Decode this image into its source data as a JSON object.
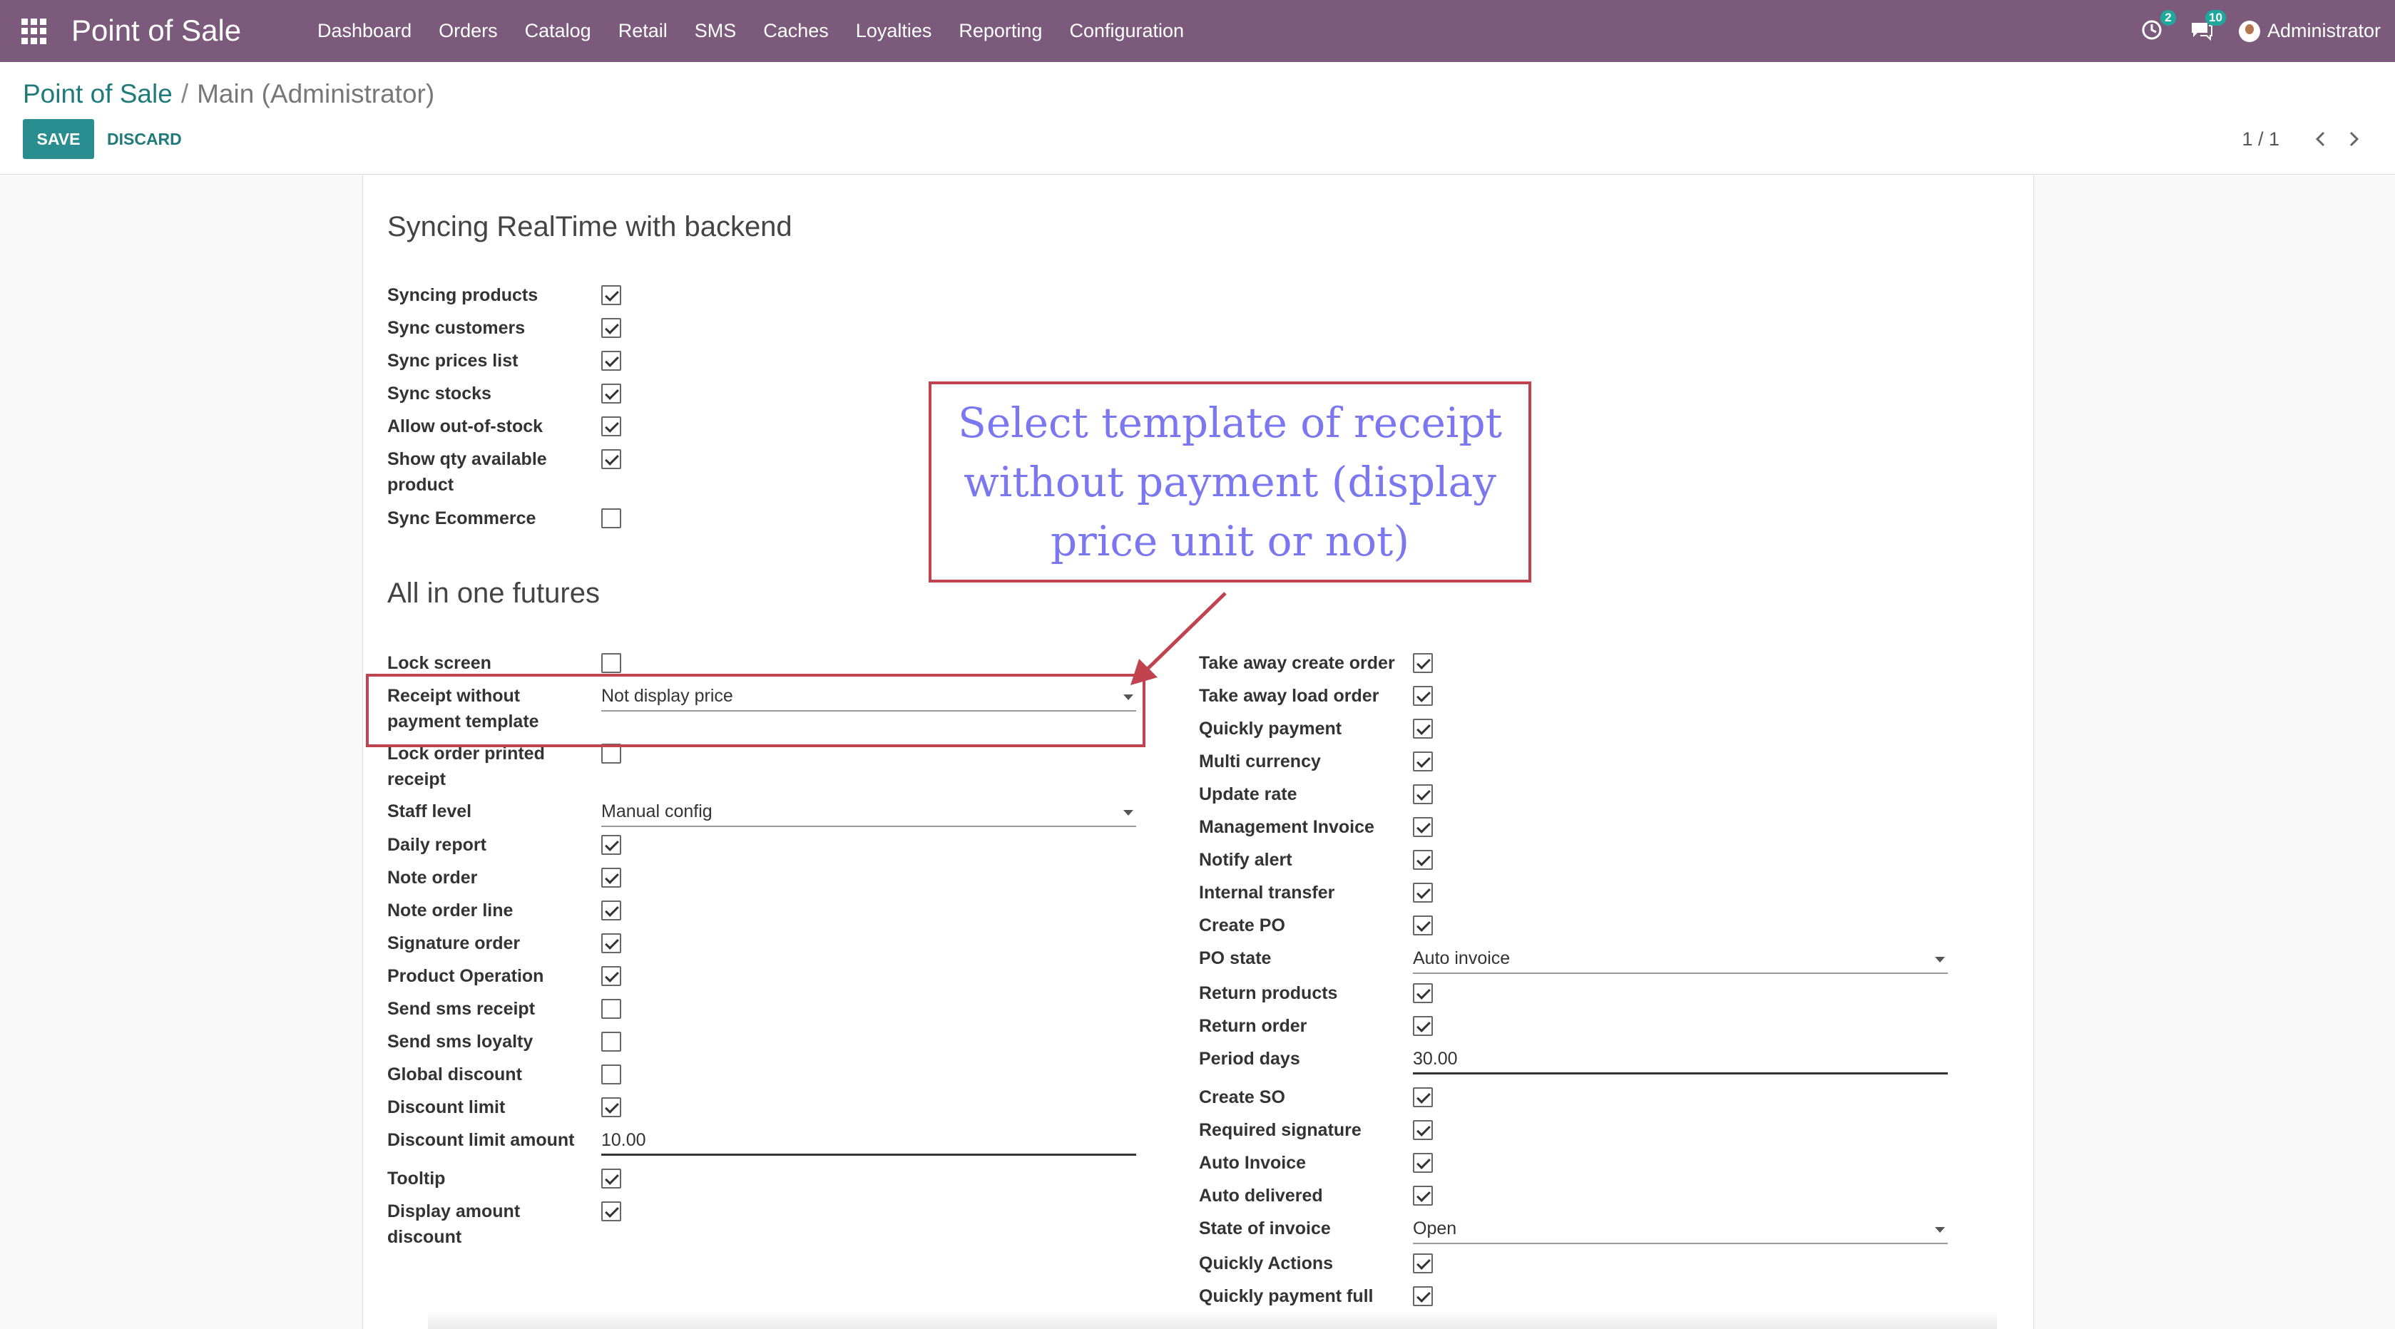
{
  "navbar": {
    "app_title": "Point of Sale",
    "menu": [
      "Dashboard",
      "Orders",
      "Catalog",
      "Retail",
      "SMS",
      "Caches",
      "Loyalties",
      "Reporting",
      "Configuration"
    ],
    "activity_badge": "2",
    "messages_badge": "10",
    "user_name": "Administrator"
  },
  "breadcrumb": {
    "parent": "Point of Sale",
    "separator": "/",
    "current": "Main (Administrator)"
  },
  "buttons": {
    "save": "SAVE",
    "discard": "DISCARD"
  },
  "pager": {
    "value": "1 / 1"
  },
  "sections": {
    "syncing_title": "Syncing RealTime with backend",
    "aio_title": "All in one futures"
  },
  "syncing_fields": [
    {
      "label": "Syncing products",
      "checked": true
    },
    {
      "label": "Sync customers",
      "checked": true
    },
    {
      "label": "Sync prices list",
      "checked": true
    },
    {
      "label": "Sync stocks",
      "checked": true
    },
    {
      "label": "Allow out-of-stock",
      "checked": true
    },
    {
      "label": "Show qty available product",
      "checked": true
    },
    {
      "label": "Sync Ecommerce",
      "checked": false
    }
  ],
  "left_fields": [
    {
      "label": "Lock screen",
      "type": "checkbox",
      "checked": false
    },
    {
      "label": "Receipt without payment template",
      "type": "select",
      "value": "Not display price"
    },
    {
      "label": "Lock order printed receipt",
      "type": "checkbox",
      "checked": false
    },
    {
      "label": "Staff level",
      "type": "select",
      "value": "Manual config"
    },
    {
      "label": "Daily report",
      "type": "checkbox",
      "checked": true
    },
    {
      "label": "Note order",
      "type": "checkbox",
      "checked": true
    },
    {
      "label": "Note order line",
      "type": "checkbox",
      "checked": true
    },
    {
      "label": "Signature order",
      "type": "checkbox",
      "checked": true
    },
    {
      "label": "Product Operation",
      "type": "checkbox",
      "checked": true
    },
    {
      "label": "Send sms receipt",
      "type": "checkbox",
      "checked": false
    },
    {
      "label": "Send sms loyalty",
      "type": "checkbox",
      "checked": false
    },
    {
      "label": "Global discount",
      "type": "checkbox",
      "checked": false
    },
    {
      "label": "Discount limit",
      "type": "checkbox",
      "checked": true
    },
    {
      "label": "Discount limit amount",
      "type": "input",
      "value": "10.00"
    },
    {
      "label": "Tooltip",
      "type": "checkbox",
      "checked": true
    },
    {
      "label": "Display amount discount",
      "type": "checkbox",
      "checked": true
    }
  ],
  "right_fields": [
    {
      "label": "Take away create order",
      "type": "checkbox",
      "checked": true
    },
    {
      "label": "Take away load order",
      "type": "checkbox",
      "checked": true
    },
    {
      "label": "Quickly payment",
      "type": "checkbox",
      "checked": true
    },
    {
      "label": "Multi currency",
      "type": "checkbox",
      "checked": true
    },
    {
      "label": "Update rate",
      "type": "checkbox",
      "checked": true
    },
    {
      "label": "Management Invoice",
      "type": "checkbox",
      "checked": true
    },
    {
      "label": "Notify alert",
      "type": "checkbox",
      "checked": true
    },
    {
      "label": "Internal transfer",
      "type": "checkbox",
      "checked": true
    },
    {
      "label": "Create PO",
      "type": "checkbox",
      "checked": true
    },
    {
      "label": "PO state",
      "type": "select",
      "value": "Auto invoice"
    },
    {
      "label": "Return products",
      "type": "checkbox",
      "checked": true
    },
    {
      "label": "Return order",
      "type": "checkbox",
      "checked": true
    },
    {
      "label": "Period days",
      "type": "input",
      "value": "30.00"
    },
    {
      "label": "Create SO",
      "type": "checkbox",
      "checked": true
    },
    {
      "label": "Required signature",
      "type": "checkbox",
      "checked": true
    },
    {
      "label": "Auto Invoice",
      "type": "checkbox",
      "checked": true
    },
    {
      "label": "Auto delivered",
      "type": "checkbox",
      "checked": true
    },
    {
      "label": "State of invoice",
      "type": "select",
      "value": "Open"
    },
    {
      "label": "Quickly Actions",
      "type": "checkbox",
      "checked": true
    },
    {
      "label": "Quickly payment full",
      "type": "checkbox",
      "checked": true
    }
  ],
  "annotation": {
    "text": "Select template of receipt without payment (display price unit or not)"
  },
  "colors": {
    "navbar": "#7c5a7b",
    "primary": "#2a8d8f",
    "annotation_border": "#c0434f",
    "annotation_text": "#7a77f0"
  }
}
